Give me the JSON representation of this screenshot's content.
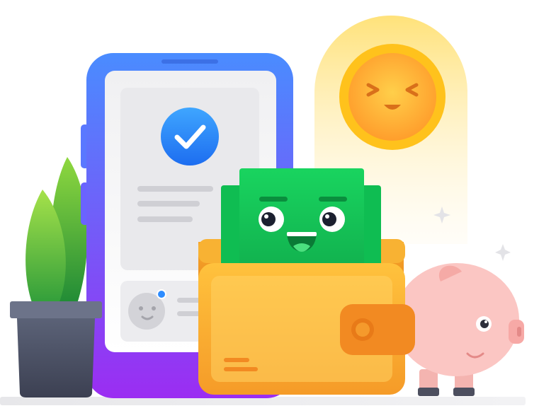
{
  "scene": {
    "subject": "phone-payment-wallet-money-illustration"
  },
  "icons": {
    "checkmark": "check-icon",
    "sparkle": "sparkle-icon",
    "coin": "coin-icon",
    "wallet": "wallet-icon",
    "cash": "cash-icon",
    "piggy_bank": "piggy-bank-icon",
    "plant": "plant-icon",
    "avatar": "avatar-icon"
  },
  "colors": {
    "phone_gradient_top": "#4a8cff",
    "phone_gradient_bottom": "#9b2df2",
    "check_badge": "#1f8bff",
    "cash_green": "#14c95a",
    "wallet_orange": "#f7b131",
    "coin_yellow": "#ffc21c",
    "piggy_pink": "#fbc6c3",
    "pot_gray": "#4d5366",
    "plant_green": "#5cc23a",
    "notification_dot": "#2d8cff"
  }
}
